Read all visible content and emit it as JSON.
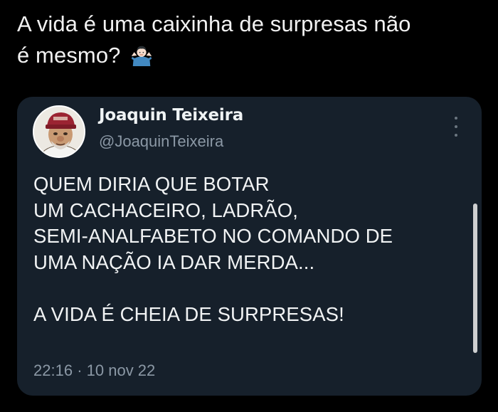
{
  "post": {
    "text_line1": "A vida é uma caixinha de surpresas não",
    "text_line2": "é mesmo?",
    "emoji_icon": "person-shrugging-emoji"
  },
  "quoted_tweet": {
    "author_name": "Joaquin Teixeira",
    "author_handle": "@JoaquinTeixeira",
    "body_lines": [
      "QUEM DIRIA QUE BOTAR",
      "UM CACHACEIRO, LADRÃO,",
      "SEMI-ANALFABETO NO COMANDO DE",
      "UMA NAÇÃO IA DAR MERDA...",
      "",
      "A VIDA É CHEIA DE SURPRESAS!"
    ],
    "time": "22:16",
    "separator": "·",
    "date": "10 nov 22"
  },
  "colors": {
    "background": "#000000",
    "card": "#16202b",
    "primary_text": "#e7e9ea",
    "secondary_text": "#8b98a5"
  }
}
